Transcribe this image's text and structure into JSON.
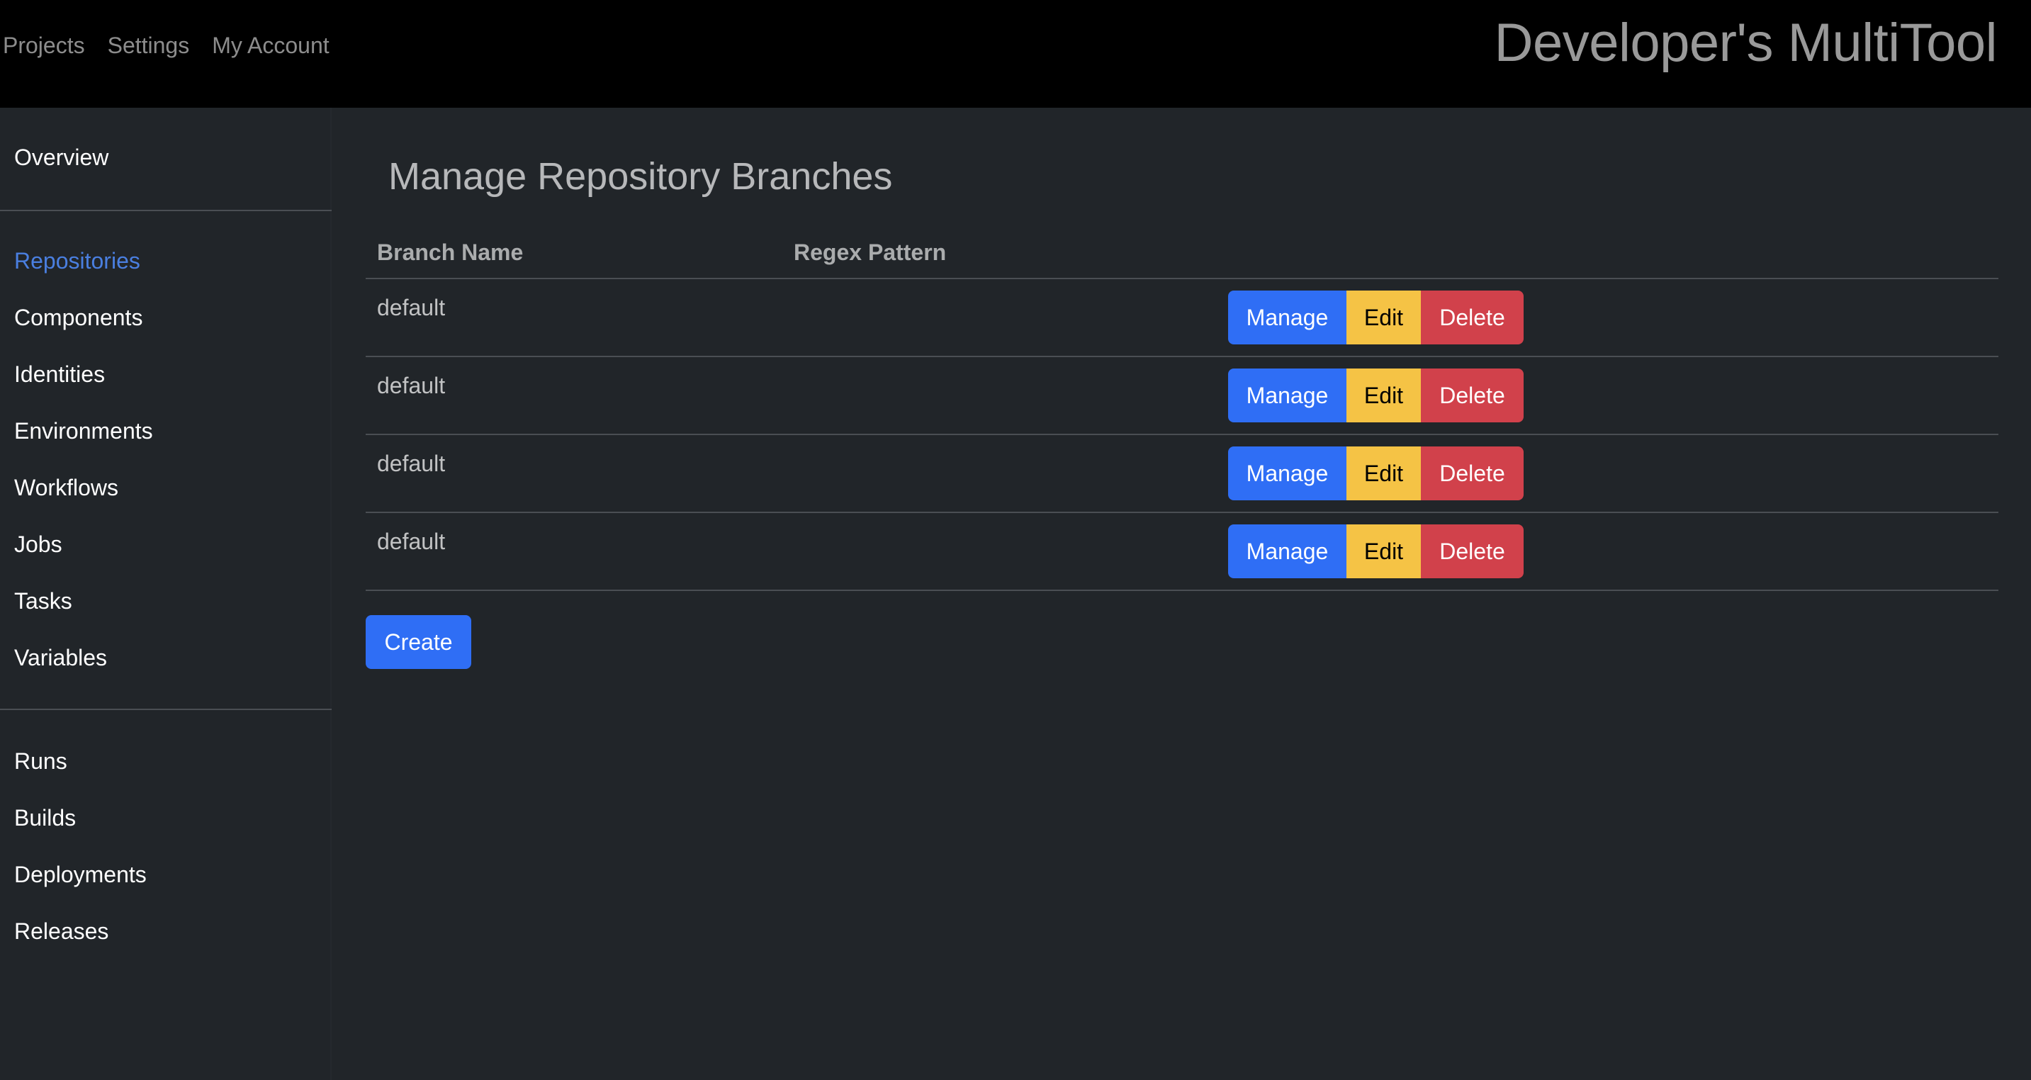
{
  "topnav": {
    "items": [
      "Projects",
      "Settings",
      "My Account"
    ],
    "brand": "Developer's MultiTool"
  },
  "sidebar": {
    "overview": "Overview",
    "group1": [
      "Repositories",
      "Components",
      "Identities",
      "Environments",
      "Workflows",
      "Jobs",
      "Tasks",
      "Variables"
    ],
    "group2": [
      "Runs",
      "Builds",
      "Deployments",
      "Releases"
    ],
    "active": "Repositories",
    "active_color": "#4a7fe0"
  },
  "main": {
    "title": "Manage Repository Branches",
    "columns": [
      "Branch Name",
      "Regex Pattern"
    ],
    "rows": [
      {
        "name": "default",
        "regex": ""
      },
      {
        "name": "default",
        "regex": ""
      },
      {
        "name": "default",
        "regex": ""
      },
      {
        "name": "default",
        "regex": ""
      }
    ],
    "actions": {
      "manage": "Manage",
      "edit": "Edit",
      "delete": "Delete"
    },
    "create_label": "Create"
  },
  "colors": {
    "primary": "#2f6ef5",
    "warning": "#f5c345",
    "danger": "#d1414b",
    "background": "#212529",
    "topbar": "#000000"
  }
}
